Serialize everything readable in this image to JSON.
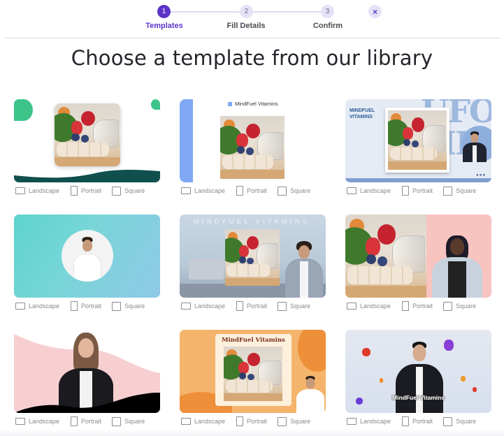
{
  "stepper": {
    "steps": [
      {
        "number": "1",
        "label": "Templates",
        "active": true
      },
      {
        "number": "2",
        "label": "Fill Details",
        "active": false
      },
      {
        "number": "3",
        "label": "Confirm",
        "active": false
      }
    ],
    "close_icon": "×"
  },
  "title": "Choose a template from our library",
  "colors": {
    "accent": "#5b34c9",
    "step_inactive_bg": "#e4e2f6"
  },
  "format_options": {
    "landscape": "Landscape",
    "portrait": "Portrait",
    "square": "Square"
  },
  "templates": [
    {
      "id": "template-1",
      "brand_text": ""
    },
    {
      "id": "template-2",
      "brand_text": "MindFuel Vitamins"
    },
    {
      "id": "template-3",
      "brand_text": "MINDFUEL VITAMINS",
      "background_text": "UFO MI",
      "dots": "●●●"
    },
    {
      "id": "template-4",
      "brand_text": ""
    },
    {
      "id": "template-5",
      "brand_text": "MINDFUEL VITAMINS"
    },
    {
      "id": "template-6",
      "brand_text": ""
    },
    {
      "id": "template-7",
      "brand_text": ""
    },
    {
      "id": "template-8",
      "brand_text": "MindFuel Vitamins"
    },
    {
      "id": "template-9",
      "brand_text": "MindFuel Vitamins"
    }
  ]
}
